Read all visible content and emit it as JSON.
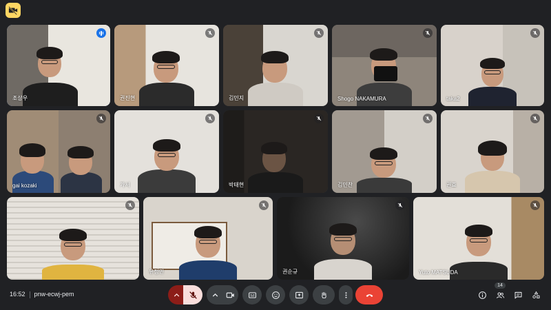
{
  "meeting": {
    "time": "16:52",
    "code": "pnw-ecwj-pem"
  },
  "participants": [
    {
      "name": "조상우",
      "muted": false,
      "speaking": true
    },
    {
      "name": "권진현",
      "muted": true
    },
    {
      "name": "김민지",
      "muted": true
    },
    {
      "name": "Shogo NAKAMURA",
      "muted": true
    },
    {
      "name": "taka2",
      "muted": true
    },
    {
      "name": "gai kozaki",
      "muted": true
    },
    {
      "name": "가서",
      "muted": true
    },
    {
      "name": "박태현",
      "muted": true
    },
    {
      "name": "김민찬",
      "muted": true
    },
    {
      "name": "권효",
      "muted": true
    },
    {
      "name": "",
      "muted": true
    },
    {
      "name": "유정민",
      "muted": true
    },
    {
      "name": "권순규",
      "muted": true
    },
    {
      "name": "Yuto MATSUDA",
      "muted": true
    }
  ],
  "people_count": "14",
  "icons": {
    "topbar": "muted-camera-badge-icon",
    "controls": [
      "chevron-up-icon",
      "mic-off-icon",
      "chevron-up-icon",
      "camera-icon",
      "captions-icon",
      "emoji-icon",
      "present-icon",
      "raise-hand-icon",
      "more-vert-icon",
      "end-call-icon"
    ],
    "right": [
      "info-icon",
      "people-icon",
      "chat-icon",
      "activities-icon"
    ]
  },
  "colors": {
    "background": "#202124",
    "active_outline": "#8ab4f8",
    "end_call": "#ea4335",
    "badge": "#fdd663"
  }
}
